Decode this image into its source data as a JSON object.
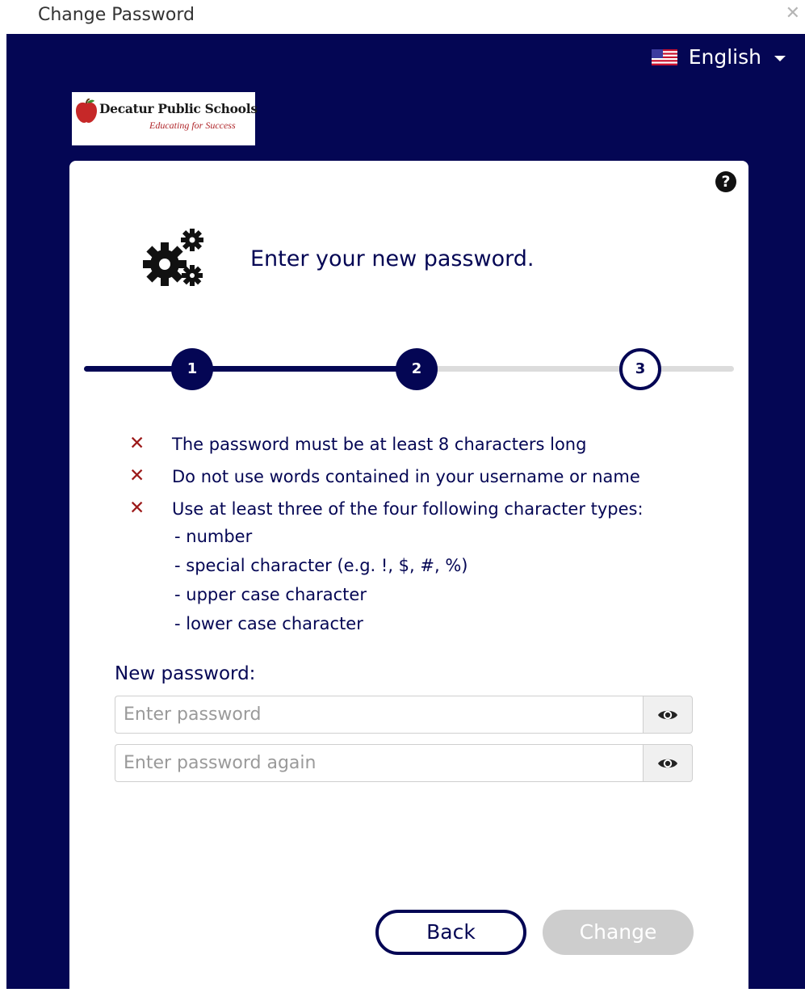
{
  "window": {
    "title": "Change Password",
    "close_label": "✕"
  },
  "language": {
    "selected": "English"
  },
  "logo": {
    "name": "Decatur Public Schools",
    "tagline": "Educating for Success"
  },
  "card": {
    "heading": "Enter your new password.",
    "help_label": "?",
    "steps": [
      {
        "number": "1",
        "state": "complete"
      },
      {
        "number": "2",
        "state": "complete"
      },
      {
        "number": "3",
        "state": "pending"
      }
    ],
    "rules": [
      {
        "text": "The password must be at least 8 characters long",
        "met": false
      },
      {
        "text": "Do not use words contained in your username or name",
        "met": false
      },
      {
        "text": "Use at least three of the four following character types:",
        "met": false
      }
    ],
    "rule_fail_marker": "✕",
    "character_types": [
      "- number",
      "- special character (e.g. !, $, #, %)",
      "- upper case character",
      "- lower case character"
    ],
    "password_label": "New password:",
    "password_placeholder": "Enter password",
    "password_value": "",
    "confirm_placeholder": "Enter password again",
    "confirm_value": "",
    "back_label": "Back",
    "change_label": "Change"
  },
  "colors": {
    "navy": "#040654",
    "error_red": "#9c1a1a",
    "disabled_button": "#cdcdcd",
    "track_pending": "#dcdcdc"
  },
  "icons": [
    "close-icon",
    "us-flag-icon",
    "caret-down-icon",
    "help-icon",
    "gears-icon",
    "cross-icon",
    "eye-icon"
  ]
}
